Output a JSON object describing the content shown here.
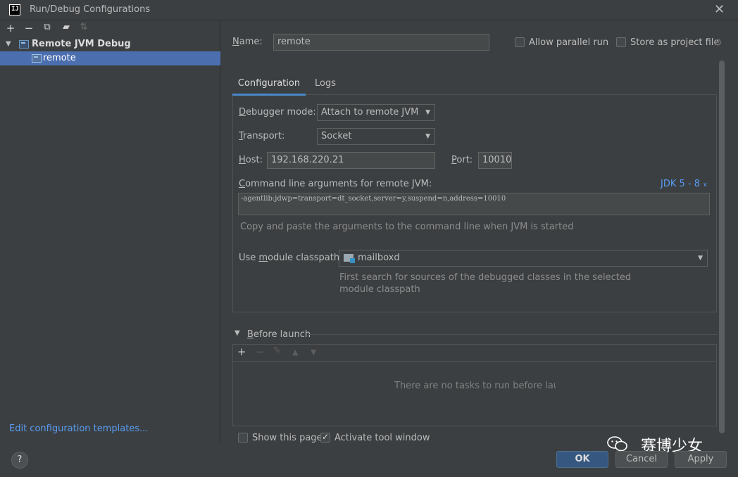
{
  "window": {
    "title": "Run/Debug Configurations",
    "app_icon_text": "IJ"
  },
  "left": {
    "toolbar": [
      "add-icon",
      "remove-icon",
      "copy-icon",
      "folder-add-icon",
      "sort-icon"
    ],
    "tree": {
      "parent_label": "Remote JVM Debug",
      "child_label": "remote"
    },
    "edit_templates_link": "Edit configuration templates..."
  },
  "right": {
    "name_label": "Name:",
    "name_value": "remote",
    "allow_parallel_label": "Allow parallel run",
    "store_project_label": "Store as project file",
    "tabs": [
      "Configuration",
      "Logs"
    ],
    "debugger_mode_label": "Debugger mode:",
    "debugger_mode_value": "Attach to remote JVM",
    "transport_label": "Transport:",
    "transport_value": "Socket",
    "host_label": "Host:",
    "host_value": "192.168.220.21",
    "port_label": "Port:",
    "port_value": "10010",
    "cmd_label": "Command line arguments for remote JVM:",
    "jdk_link": "JDK 5 - 8",
    "cmd_value": "-agentlib:jdwp=transport=dt_socket,server=y,suspend=n,address=10010",
    "cmd_hint": "Copy and paste the arguments to the command line when JVM is started",
    "module_label": "Use module classpath:",
    "module_value": "mailboxd",
    "module_hint_line1": "First search for sources of the debugged classes in the selected",
    "module_hint_line2": "module classpath",
    "before_launch_label": "Before launch",
    "before_launch_empty": "There are no tasks to run before launch",
    "show_page_label": "Show this page",
    "activate_tool_label": "Activate tool window",
    "show_page_checked": false,
    "activate_tool_checked": true,
    "allow_parallel_checked": false,
    "store_project_checked": false
  },
  "footer": {
    "help": "?",
    "ok": "OK",
    "cancel": "Cancel",
    "apply": "Apply",
    "watermark": "赛博少女"
  },
  "colors": {
    "background": "#3c3f41",
    "selection": "#4b6eaf",
    "link": "#589df6",
    "ok_button": "#365880"
  }
}
